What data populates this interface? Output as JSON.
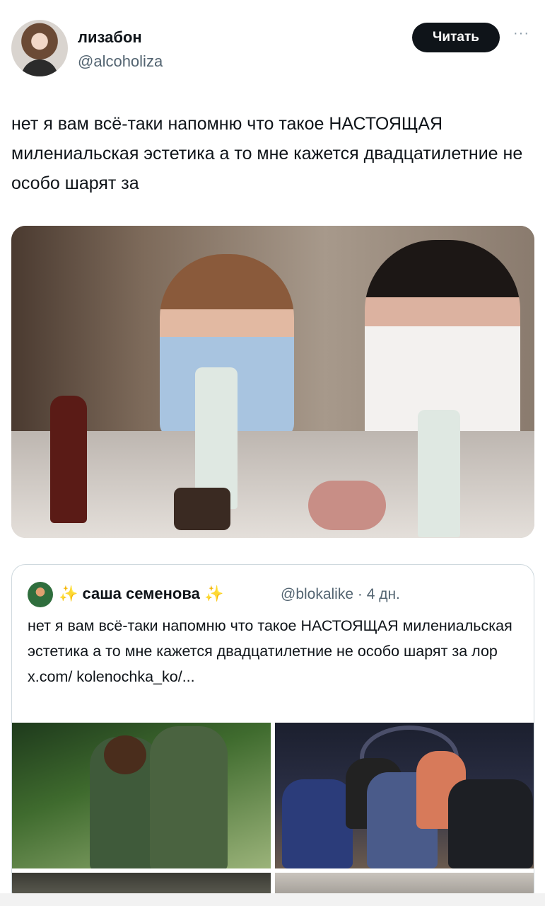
{
  "author": {
    "name": "лизабон",
    "handle": "@alcoholiza",
    "follow_label": "Читать",
    "more_label": "···"
  },
  "post": {
    "text": "нет я вам всё-таки напомню что такое НАСТОЯЩАЯ милениальская эстетика а то мне кажется двадцатилетние не особо шарят за"
  },
  "quoted": {
    "sparkle_left": "✨",
    "name": "саша семенова",
    "sparkle_right": "✨",
    "handle_meta": "@blokalike · 4 дн.",
    "text": "нет я вам всё-таки напомню что такое НАСТОЯЩАЯ милениальская эстетика а то мне кажется двадцатилетние не особо шарят за лор x.com/ kolenochka_ko/..."
  }
}
